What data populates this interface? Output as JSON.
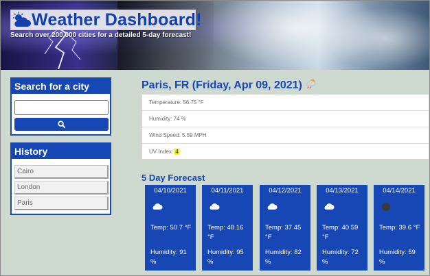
{
  "header": {
    "title": "Weather Dashboard!",
    "subtitle": "Search over 200,000 cities for a detailed 5-day forecast!"
  },
  "search": {
    "heading": "Search for a city",
    "input_value": "",
    "button_icon": "search-icon"
  },
  "history": {
    "heading": "History",
    "items": [
      "Cairo",
      "London",
      "Paris"
    ]
  },
  "current": {
    "heading": "Paris, FR (Friday, Apr 09, 2021)",
    "icon": "cloud-sun-rain-icon",
    "temperature": "Temperature: 56.75 °F",
    "humidity": "Humidity: 74 %",
    "wind": "Wind Speed: 5.59 MPH",
    "uv_label": "UV Index: ",
    "uv_value": "4",
    "uv_color": "#f2f200"
  },
  "forecast": {
    "heading": "5 Day Forecast",
    "days": [
      {
        "date": "04/10/2021",
        "icon": "cloud-icon",
        "temp": "Temp: 50.7 °F",
        "humidity": "Humidity: 91 %"
      },
      {
        "date": "04/11/2021",
        "icon": "cloud-icon",
        "temp": "Temp: 48.16 °F",
        "humidity": "Humidity: 95 %"
      },
      {
        "date": "04/12/2021",
        "icon": "cloud-icon",
        "temp": "Temp: 37.45 °F",
        "humidity": "Humidity: 82 %"
      },
      {
        "date": "04/13/2021",
        "icon": "cloud-icon",
        "temp": "Temp: 40.59 °F",
        "humidity": "Humidity: 72 %"
      },
      {
        "date": "04/14/2021",
        "icon": "dark-cloud-icon",
        "temp": "Temp: 39.6 °F",
        "humidity": "Humidity: 59 %"
      }
    ]
  },
  "colors": {
    "accent": "#1746b5",
    "page_background": "#ced9d0"
  }
}
